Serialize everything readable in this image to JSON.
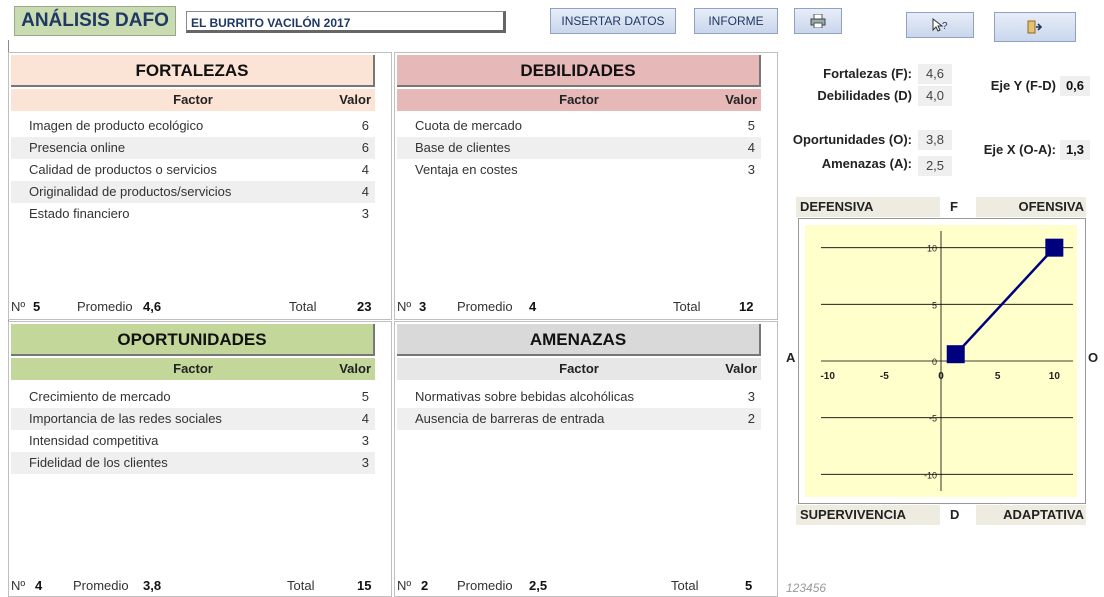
{
  "header": {
    "title": "ANÁLISIS DAFO",
    "company": "EL BURRITO VACILÓN 2017",
    "btn_insert": "INSERTAR DATOS",
    "btn_report": "INFORME",
    "print_icon": "printer-icon",
    "help_icon": "help-cursor-icon",
    "exit_icon": "exit-door-icon"
  },
  "labels": {
    "factor": "Factor",
    "valor": "Valor",
    "num": "Nº",
    "promedio": "Promedio",
    "total": "Total"
  },
  "fortalezas": {
    "title": "FORTALEZAS",
    "color": "#fbe4d5",
    "items": [
      {
        "factor": "Imagen de producto ecológico",
        "valor": "6"
      },
      {
        "factor": "Presencia online",
        "valor": "6"
      },
      {
        "factor": "Calidad de productos o servicios",
        "valor": "4"
      },
      {
        "factor": "Originalidad de productos/servicios",
        "valor": "4"
      },
      {
        "factor": "Estado financiero",
        "valor": "3"
      }
    ],
    "count": "5",
    "promedio": "4,6",
    "total": "23"
  },
  "debilidades": {
    "title": "DEBILIDADES",
    "color": "#e6b8b7",
    "items": [
      {
        "factor": "Cuota de mercado",
        "valor": "5"
      },
      {
        "factor": "Base de clientes",
        "valor": "4"
      },
      {
        "factor": "Ventaja en costes",
        "valor": "3"
      }
    ],
    "count": "3",
    "promedio": "4",
    "total": "12"
  },
  "oportunidades": {
    "title": "OPORTUNIDADES",
    "color": "#c4d79b",
    "items": [
      {
        "factor": "Crecimiento de mercado",
        "valor": "5"
      },
      {
        "factor": "Importancia de las redes sociales",
        "valor": "4"
      },
      {
        "factor": "Intensidad competitiva",
        "valor": "3"
      },
      {
        "factor": "Fidelidad de los clientes",
        "valor": "3"
      }
    ],
    "count": "4",
    "promedio": "3,8",
    "total": "15"
  },
  "amenazas": {
    "title": "AMENAZAS",
    "color": "#d9d9d9",
    "items": [
      {
        "factor": "Normativas sobre bebidas alcohólicas",
        "valor": "3"
      },
      {
        "factor": "Ausencia de barreras de entrada",
        "valor": "2"
      }
    ],
    "count": "2",
    "promedio": "2,5",
    "total": "5"
  },
  "summary": {
    "f_label": "Fortalezas (F):",
    "f_value": "4,6",
    "d_label": "Debilidades (D)",
    "d_value": "4,0",
    "o_label": "Oportunidades (O):",
    "o_value": "3,8",
    "a_label": "Amenazas (A):",
    "a_value": "2,5",
    "y_label": "Eje Y (F-D)",
    "y_value": "0,6",
    "x_label": "Eje X (O-A):",
    "x_value": "1,3"
  },
  "quadrants": {
    "defensiva": "DEFENSIVA",
    "f": "F",
    "ofensiva": "OFENSIVA",
    "supervivencia": "SUPERVIVENCIA",
    "d": "D",
    "adaptativa": "ADAPTATIVA",
    "a": "A",
    "o": "O"
  },
  "chart_data": {
    "type": "scatter",
    "x_ticks": [
      "-10",
      "-5",
      "0",
      "5",
      "10"
    ],
    "y_ticks": [
      "10",
      "5",
      "0",
      "-5",
      "-10"
    ],
    "xlim": [
      -12,
      12
    ],
    "ylim": [
      -12,
      12
    ],
    "points": [
      {
        "x": 1.3,
        "y": 0.6
      },
      {
        "x": 10,
        "y": 10
      }
    ],
    "line_color": "#00007f",
    "bg_color": "#ffffcc"
  },
  "footer_code": "123456"
}
